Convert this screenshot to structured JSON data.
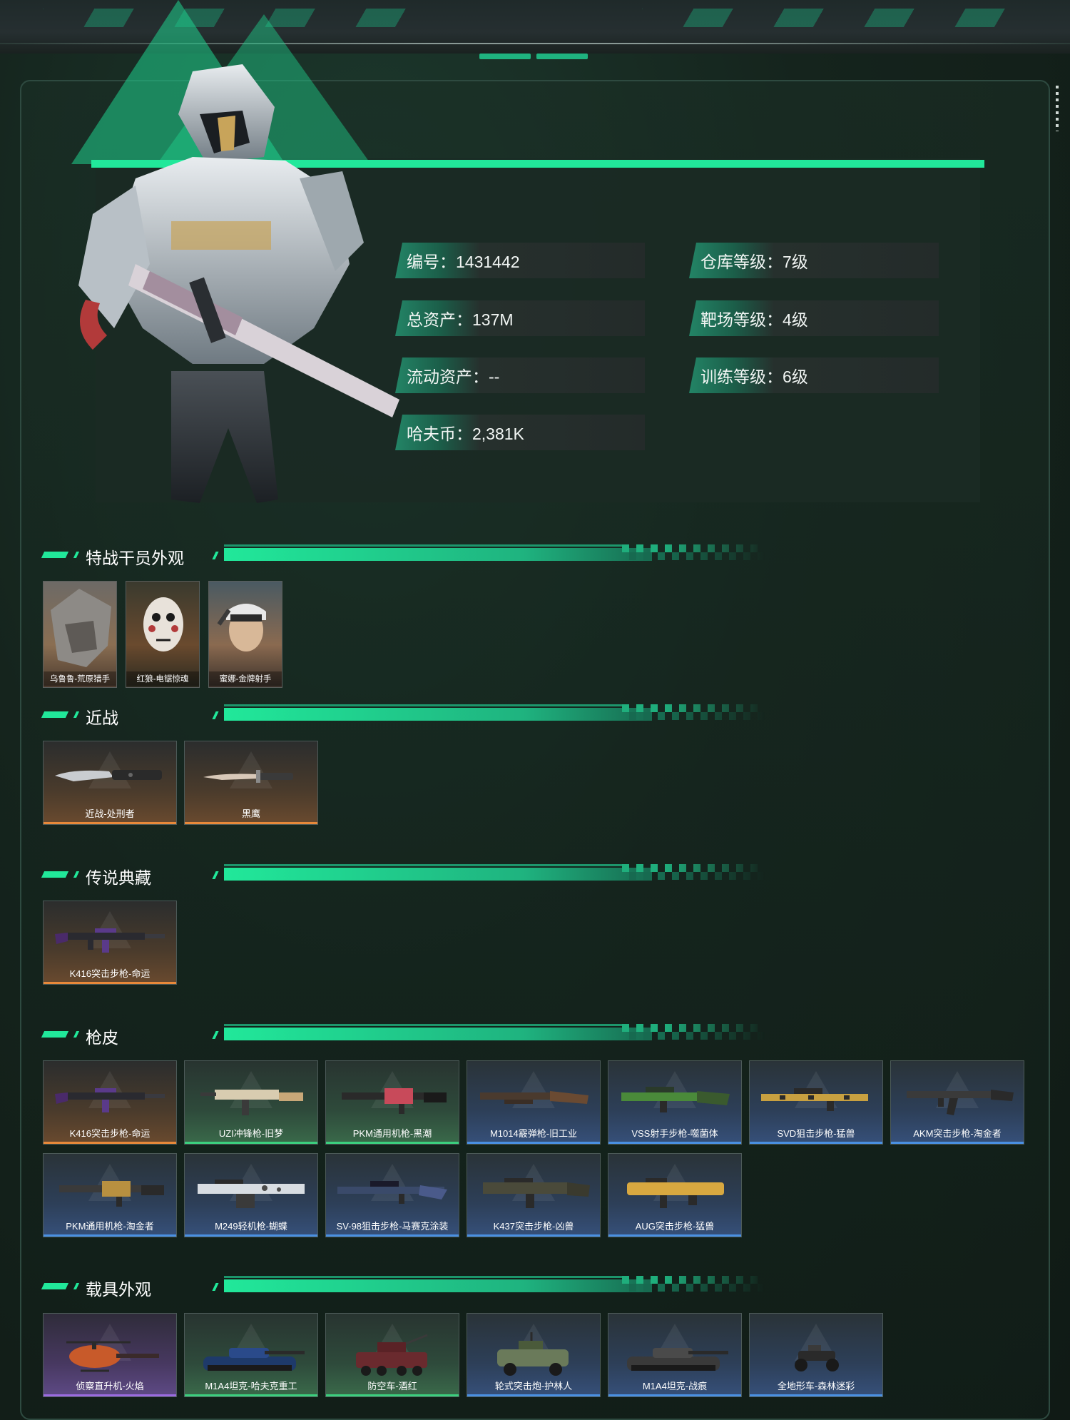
{
  "stats": {
    "id": "编号：1431442",
    "warehouse_level": "仓库等级：7级",
    "total_assets": "总资产：137M",
    "range_level": "靶场等级：4级",
    "liquid_assets": "流动资产：--",
    "training_level": "训练等级：6级",
    "havoc_coins": "哈夫币：2,381K"
  },
  "sections": {
    "operators": {
      "title": "特战干员外观",
      "items": [
        "乌鲁鲁-荒原猎手",
        "红狼-电锯惊魂",
        "蜜娜-金牌射手"
      ]
    },
    "melee": {
      "title": "近战",
      "items": [
        "近战-处刑者",
        "黑鹰"
      ]
    },
    "legendary": {
      "title": "传说典藏",
      "items": [
        "K416突击步枪-命运"
      ]
    },
    "gun_skins": {
      "title": "枪皮",
      "items": [
        "K416突击步枪-命运",
        "UZI冲锋枪-旧梦",
        "PKM通用机枪-黑潮",
        "M1014霰弹枪-旧工业",
        "VSS射手步枪-噬菌体",
        "SVD狙击步枪-猛兽",
        "AKM突击步枪-淘金者",
        "PKM通用机枪-淘金者",
        "M249轻机枪-蝴蝶",
        "SV-98狙击步枪-马赛克涂装",
        "K437突击步枪-凶兽",
        "AUG突击步枪-猛兽"
      ]
    },
    "vehicles": {
      "title": "载具外观",
      "items": [
        "侦察直升机-火焰",
        "M1A4坦克-哈夫克重工",
        "防空车-酒红",
        "轮式突击炮-护林人",
        "M1A4坦克-战痕",
        "全地形车-森林迷彩"
      ]
    }
  },
  "colors": {
    "accent": "#21e89a",
    "rarity_orange": "#e8893a",
    "rarity_green": "#3ccf7e",
    "rarity_blue": "#4a90e2",
    "rarity_purple": "#9b6be0"
  }
}
